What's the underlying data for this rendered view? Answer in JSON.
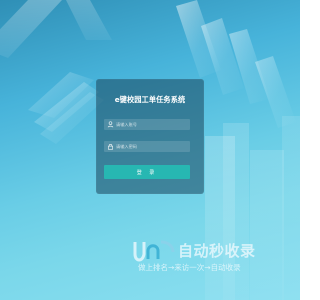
{
  "login": {
    "title": "e键校园工单任务系统",
    "username_placeholder": "请输入账号",
    "password_placeholder": "请输入密码",
    "submit_label": "登 录"
  },
  "watermark": {
    "brand": "自动秒收录",
    "slogan": "做上排名→来访一次→自动收录"
  },
  "colors": {
    "background_dark": "#2f8fb6",
    "background_light": "#8bdff0",
    "card": "#17465d",
    "button": "#27b7b2"
  },
  "icons": {
    "username": "user-icon",
    "password": "lock-icon"
  }
}
